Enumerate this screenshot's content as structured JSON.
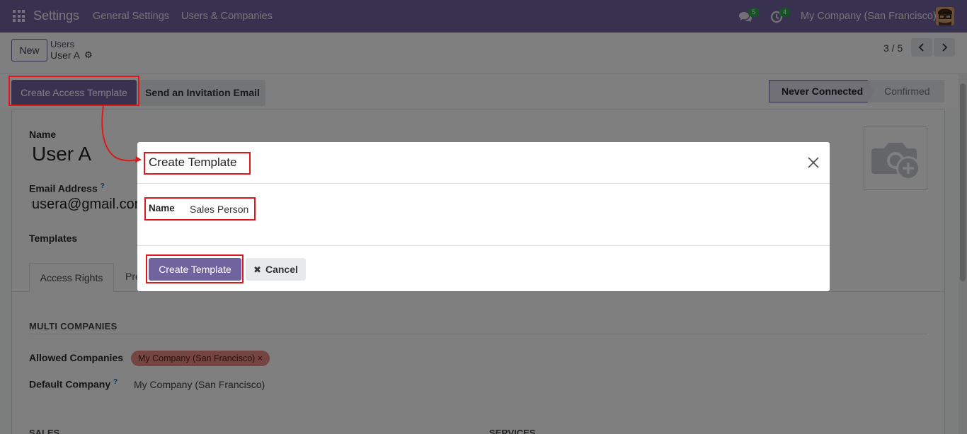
{
  "navbar": {
    "app_name": "Settings",
    "menu": [
      "General Settings",
      "Users & Companies"
    ],
    "messages_count": "5",
    "activities_count": "4",
    "company": "My Company (San Francisco)"
  },
  "control_panel": {
    "new_label": "New",
    "breadcrumb_parent": "Users",
    "breadcrumb_current": "User A",
    "pager_value": "3 / 5"
  },
  "statusbar": {
    "create_access_template": "Create Access Template",
    "send_invitation": "Send an Invitation Email",
    "stages": [
      "Never Connected",
      "Confirmed"
    ],
    "current_stage": "Never Connected"
  },
  "form": {
    "name_label": "Name",
    "name_value": "User A",
    "email_label": "Email Address",
    "email_help": "?",
    "email_value": "usera@gmail.com",
    "templates_label": "Templates",
    "tabs": [
      "Access Rights",
      "Pre"
    ],
    "multi_companies_title": "MULTI COMPANIES",
    "allowed_companies_label": "Allowed Companies",
    "allowed_companies_tag": "My Company (San Francisco) ×",
    "default_company_label": "Default Company",
    "default_company_help": "?",
    "default_company_value": "My Company (San Francisco)",
    "sales_title": "SALES",
    "services_title": "SERVICES"
  },
  "modal": {
    "title": "Create Template",
    "name_label": "Name",
    "name_value": "Sales Person",
    "create_label": "Create Template",
    "cancel_label": "Cancel"
  },
  "colors": {
    "brand": "#71639e",
    "highlight": "#e0181a",
    "tag": "#e98b83",
    "badge": "#28a745"
  }
}
